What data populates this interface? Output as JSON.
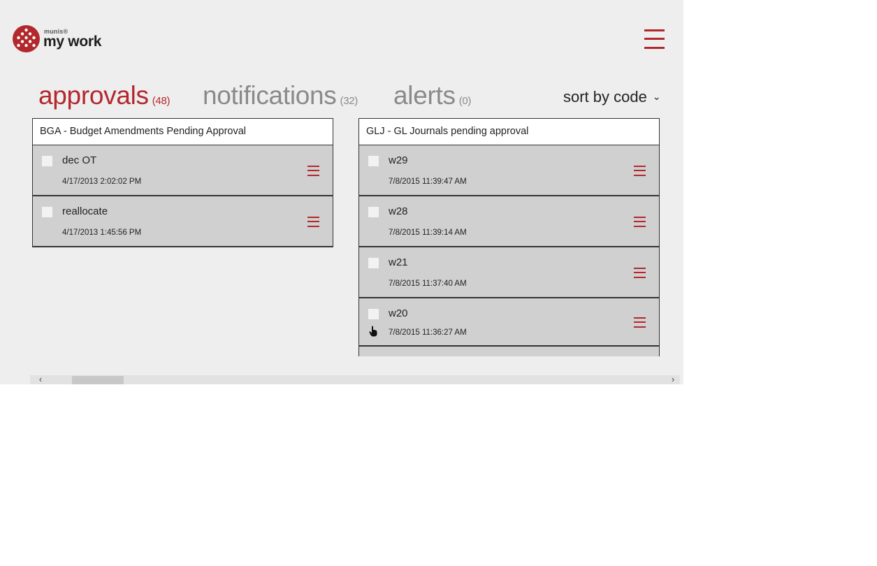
{
  "app": {
    "brand_small": "munis®",
    "brand_title": "my work",
    "menu_icon": "hamburger-icon"
  },
  "tabs": [
    {
      "label": "approvals",
      "count": "(48)",
      "active": true
    },
    {
      "label": "notifications",
      "count": "(32)",
      "active": false
    },
    {
      "label": "alerts",
      "count": "(0)",
      "active": false
    }
  ],
  "sort": {
    "label": "sort by code",
    "icon": "chevron-down-icon"
  },
  "panels": [
    {
      "header": "BGA - Budget Amendments Pending Approval",
      "items": [
        {
          "title": "dec OT",
          "date": "4/17/2013 2:02:02 PM"
        },
        {
          "title": "reallocate",
          "date": "4/17/2013 1:45:56 PM"
        }
      ]
    },
    {
      "header": "GLJ - GL Journals pending approval",
      "items": [
        {
          "title": "w29",
          "date": "7/8/2015 11:39:47 AM"
        },
        {
          "title": "w28",
          "date": "7/8/2015 11:39:14 AM"
        },
        {
          "title": "w21",
          "date": "7/8/2015 11:37:40 AM"
        },
        {
          "title": "w20",
          "date": "7/8/2015 11:36:27 AM",
          "held": true
        }
      ]
    }
  ],
  "scrollbar": {
    "left_icon": "chevron-left-icon",
    "right_icon": "chevron-right-icon"
  },
  "colors": {
    "accent": "#b3282d",
    "background": "#eeeeee",
    "item_background": "#d0d0d0"
  }
}
